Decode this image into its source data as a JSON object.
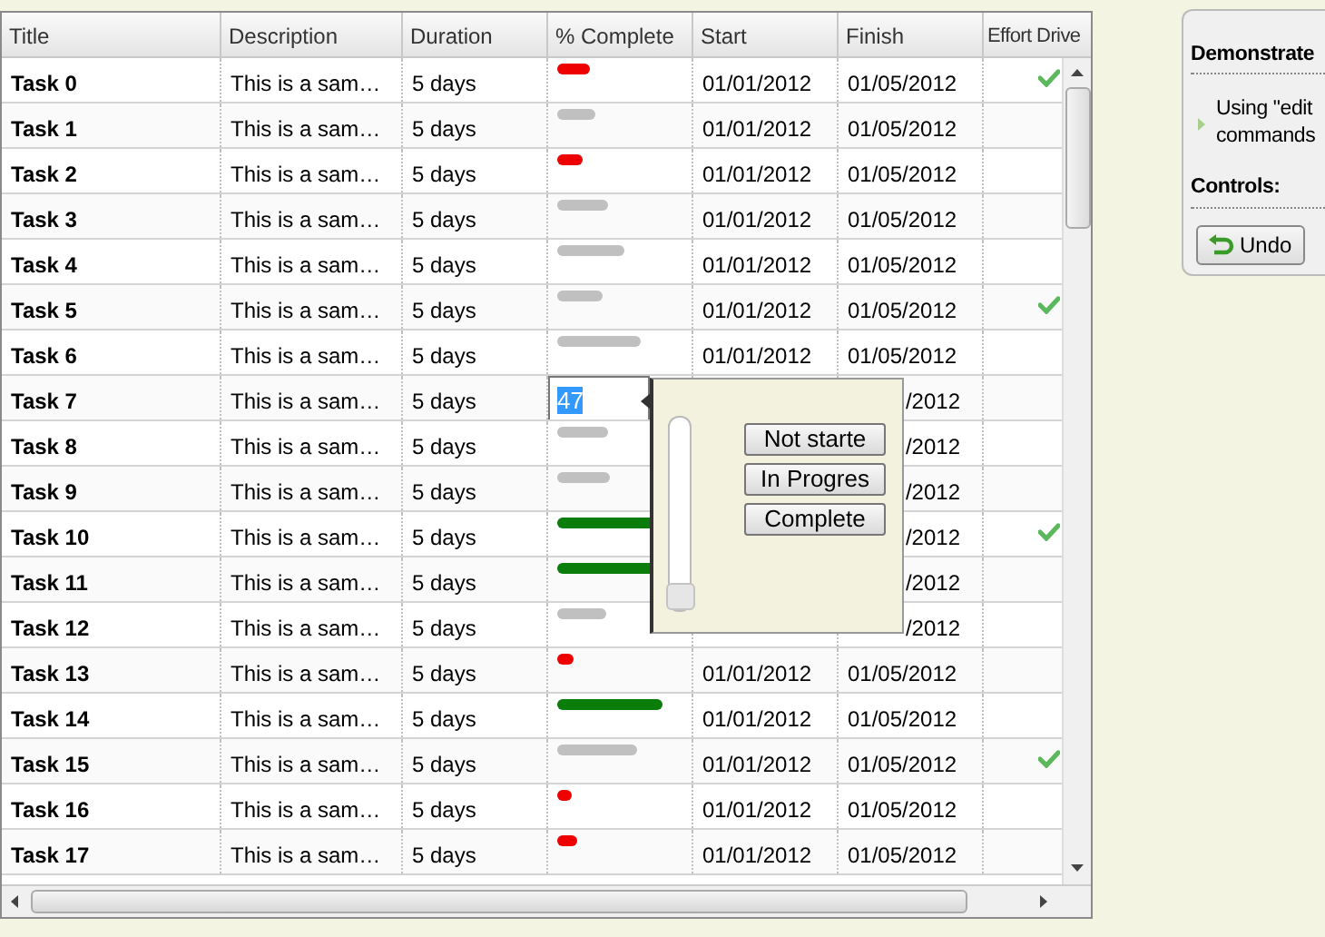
{
  "grid": {
    "columns": [
      "Title",
      "Description",
      "Duration",
      "% Complete",
      "Start",
      "Finish",
      "Effort Drive"
    ],
    "rows": [
      {
        "title": "Task 0",
        "description": "This is a sam…",
        "duration": "5 days",
        "level": 0.25,
        "start": "01/01/2012",
        "finish": "01/05/2012",
        "effort_driven": true
      },
      {
        "title": "Task 1",
        "description": "This is a sam…",
        "duration": "5 days",
        "level": 0.3,
        "start": "01/01/2012",
        "finish": "01/05/2012",
        "effort_driven": false
      },
      {
        "title": "Task 2",
        "description": "This is a sam…",
        "duration": "5 days",
        "level": 0.2,
        "start": "01/01/2012",
        "finish": "01/05/2012",
        "effort_driven": false
      },
      {
        "title": "Task 3",
        "description": "This is a sam…",
        "duration": "5 days",
        "level": 0.4,
        "start": "01/01/2012",
        "finish": "01/05/2012",
        "effort_driven": false
      },
      {
        "title": "Task 4",
        "description": "This is a sam…",
        "duration": "5 days",
        "level": 0.53,
        "start": "01/01/2012",
        "finish": "01/05/2012",
        "effort_driven": false
      },
      {
        "title": "Task 5",
        "description": "This is a sam…",
        "duration": "5 days",
        "level": 0.36,
        "start": "01/01/2012",
        "finish": "01/05/2012",
        "effort_driven": true
      },
      {
        "title": "Task 6",
        "description": "This is a sam…",
        "duration": "5 days",
        "level": 0.66,
        "start": "01/01/2012",
        "finish": "01/05/2012",
        "effort_driven": false
      },
      {
        "title": "Task 7",
        "description": "This is a sam…",
        "duration": "5 days",
        "kind": "editor",
        "value": "47",
        "finish": "/2012",
        "effort_driven": false
      },
      {
        "title": "Task 8",
        "description": "This is a sam…",
        "duration": "5 days",
        "level": 0.4,
        "finish": "/2012",
        "effort_driven": false
      },
      {
        "title": "Task 9",
        "description": "This is a sam…",
        "duration": "5 days",
        "level": 0.42,
        "finish": "/2012",
        "effort_driven": false
      },
      {
        "title": "Task 10",
        "description": "This is a sam…",
        "duration": "5 days",
        "level": 0.9,
        "finish": "/2012",
        "effort_driven": true
      },
      {
        "title": "Task 11",
        "description": "This is a sam…",
        "duration": "5 days",
        "level": 0.88,
        "finish": "/2012",
        "effort_driven": false
      },
      {
        "title": "Task 12",
        "description": "This is a sam…",
        "duration": "5 days",
        "level": 0.38,
        "finish": "/2012",
        "effort_driven": false
      },
      {
        "title": "Task 13",
        "description": "This is a sam…",
        "duration": "5 days",
        "level": 0.13,
        "start": "01/01/2012",
        "finish": "01/05/2012",
        "effort_driven": false
      },
      {
        "title": "Task 14",
        "description": "This is a sam…",
        "duration": "5 days",
        "level": 0.83,
        "start": "01/01/2012",
        "finish": "01/05/2012",
        "effort_driven": false
      },
      {
        "title": "Task 15",
        "description": "This is a sam…",
        "duration": "5 days",
        "level": 0.63,
        "start": "01/01/2012",
        "finish": "01/05/2012",
        "effort_driven": true
      },
      {
        "title": "Task 16",
        "description": "This is a sam…",
        "duration": "5 days",
        "level": 0.12,
        "start": "01/01/2012",
        "finish": "01/05/2012",
        "effort_driven": false
      },
      {
        "title": "Task 17",
        "description": "This is a sam…",
        "duration": "5 days",
        "level": 0.16,
        "start": "01/01/2012",
        "finish": "01/05/2012",
        "effort_driven": false
      }
    ],
    "editor": {
      "slider": {
        "level": 0
      },
      "buttons": [
        "Not starte",
        "In Progres",
        "Complete"
      ]
    }
  },
  "panel": {
    "title": "Demonstrate",
    "items": [
      "Using \"edit\ncommands"
    ],
    "controls_title": "Controls:",
    "undo_label": "Undo"
  }
}
